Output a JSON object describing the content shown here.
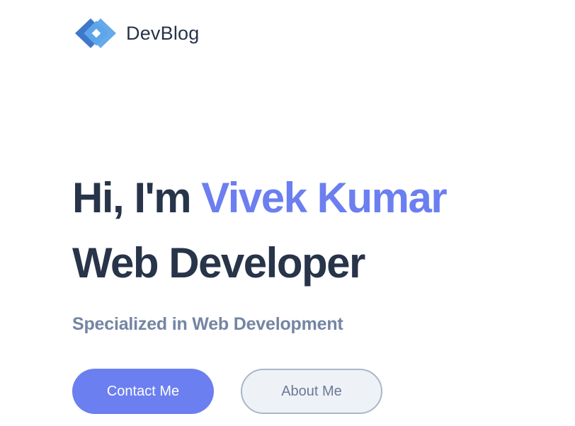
{
  "header": {
    "brand": "DevBlog",
    "logo_icon": "diamond-chain-logo-icon",
    "logo_colors": [
      "#3f78c9",
      "#5da5e8"
    ]
  },
  "hero": {
    "greeting": "Hi, I'm ",
    "name": "Vivek Kumar",
    "role": "Web Developer",
    "subtitle": "Specialized in Web Development"
  },
  "actions": {
    "contact_label": "Contact Me",
    "about_label": "About Me"
  },
  "colors": {
    "heading": "#273449",
    "accent": "#6b7ff0",
    "subtitle": "#7485a3",
    "secondary_bg": "#eef2f7",
    "secondary_border": "#a9b7c9"
  }
}
